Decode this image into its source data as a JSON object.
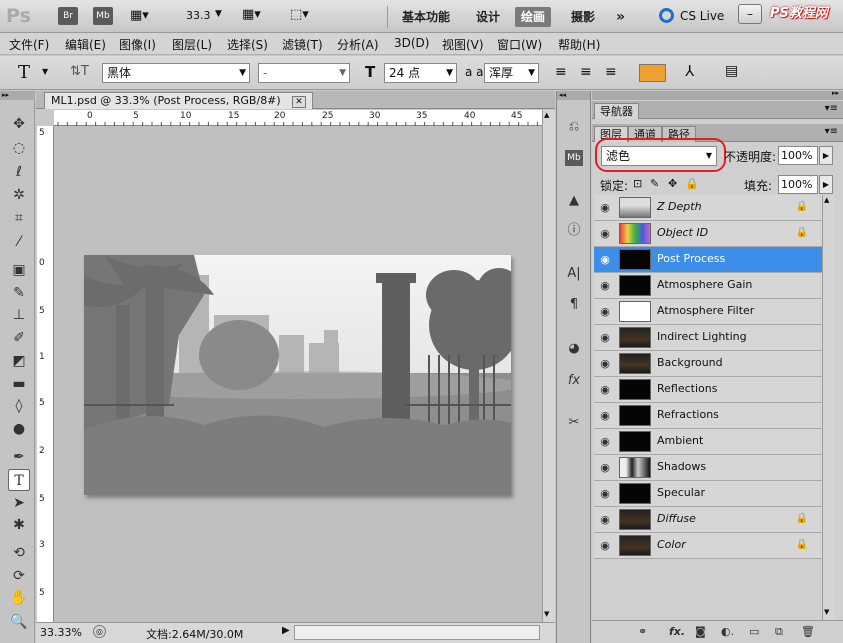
{
  "appbar": {
    "logo": "Ps",
    "bridge": "Br",
    "minibridge": "Mb",
    "zoom": "33.3",
    "workspaces": [
      "基本功能",
      "设计",
      "绘画",
      "摄影"
    ],
    "active_workspace": "绘画",
    "more": "»",
    "cslive": "CS Live",
    "watermark": "PS教程网"
  },
  "menubar": [
    "文件(F)",
    "编辑(E)",
    "图像(I)",
    "图层(L)",
    "选择(S)",
    "滤镜(T)",
    "分析(A)",
    "3D(D)",
    "视图(V)",
    "窗口(W)",
    "帮助(H)"
  ],
  "options": {
    "font_family": "黑体",
    "font_style": "-",
    "font_size": "24 点",
    "aa_label": "a a",
    "antialias": "浑厚"
  },
  "document": {
    "tab_title": "ML1.psd @ 33.3% (Post Process, RGB/8#)",
    "ruler_top": [
      "0",
      "5",
      "10",
      "15",
      "20",
      "25",
      "30",
      "35",
      "40",
      "45"
    ],
    "ruler_left": [
      "5",
      "0",
      "5",
      "1",
      "5",
      "2",
      "5",
      "3",
      "5"
    ],
    "status_zoom": "33.33%",
    "status_doc": "文档:2.64M/30.0M"
  },
  "layers_panel": {
    "navigator_tab": "导航器",
    "tabs": [
      "图层",
      "通道",
      "路径"
    ],
    "blend_mode": "滤色",
    "opacity_label": "不透明度:",
    "opacity": "100%",
    "lock_label": "锁定:",
    "fill_label": "填充:",
    "fill": "100%",
    "layers": [
      {
        "name": "Z Depth",
        "italic": true,
        "locked": true,
        "thumb": "zdepth"
      },
      {
        "name": "Object ID",
        "italic": true,
        "locked": true,
        "thumb": "objid"
      },
      {
        "name": "Post Process",
        "italic": false,
        "locked": false,
        "selected": true,
        "thumb": "dark"
      },
      {
        "name": "Atmosphere Gain",
        "italic": false,
        "locked": false,
        "thumb": "dark"
      },
      {
        "name": "Atmosphere Filter",
        "italic": false,
        "locked": false,
        "thumb": "white"
      },
      {
        "name": "Indirect Lighting",
        "italic": false,
        "locked": false,
        "thumb": "scene"
      },
      {
        "name": "Background",
        "italic": false,
        "locked": false,
        "thumb": "scene"
      },
      {
        "name": "Reflections",
        "italic": false,
        "locked": false,
        "thumb": "dark"
      },
      {
        "name": "Refractions",
        "italic": false,
        "locked": false,
        "thumb": "dark"
      },
      {
        "name": "Ambient",
        "italic": false,
        "locked": false,
        "thumb": "dark"
      },
      {
        "name": "Shadows",
        "italic": false,
        "locked": false,
        "thumb": "shadows"
      },
      {
        "name": "Specular",
        "italic": false,
        "locked": false,
        "thumb": "dark"
      },
      {
        "name": "Diffuse",
        "italic": true,
        "locked": true,
        "thumb": "scene"
      },
      {
        "name": "Color",
        "italic": true,
        "locked": true,
        "thumb": "scene"
      }
    ]
  },
  "colors": {
    "swatch": "#f0a030",
    "selection": "#3d8ee8",
    "highlight_circle": "#e02020"
  }
}
